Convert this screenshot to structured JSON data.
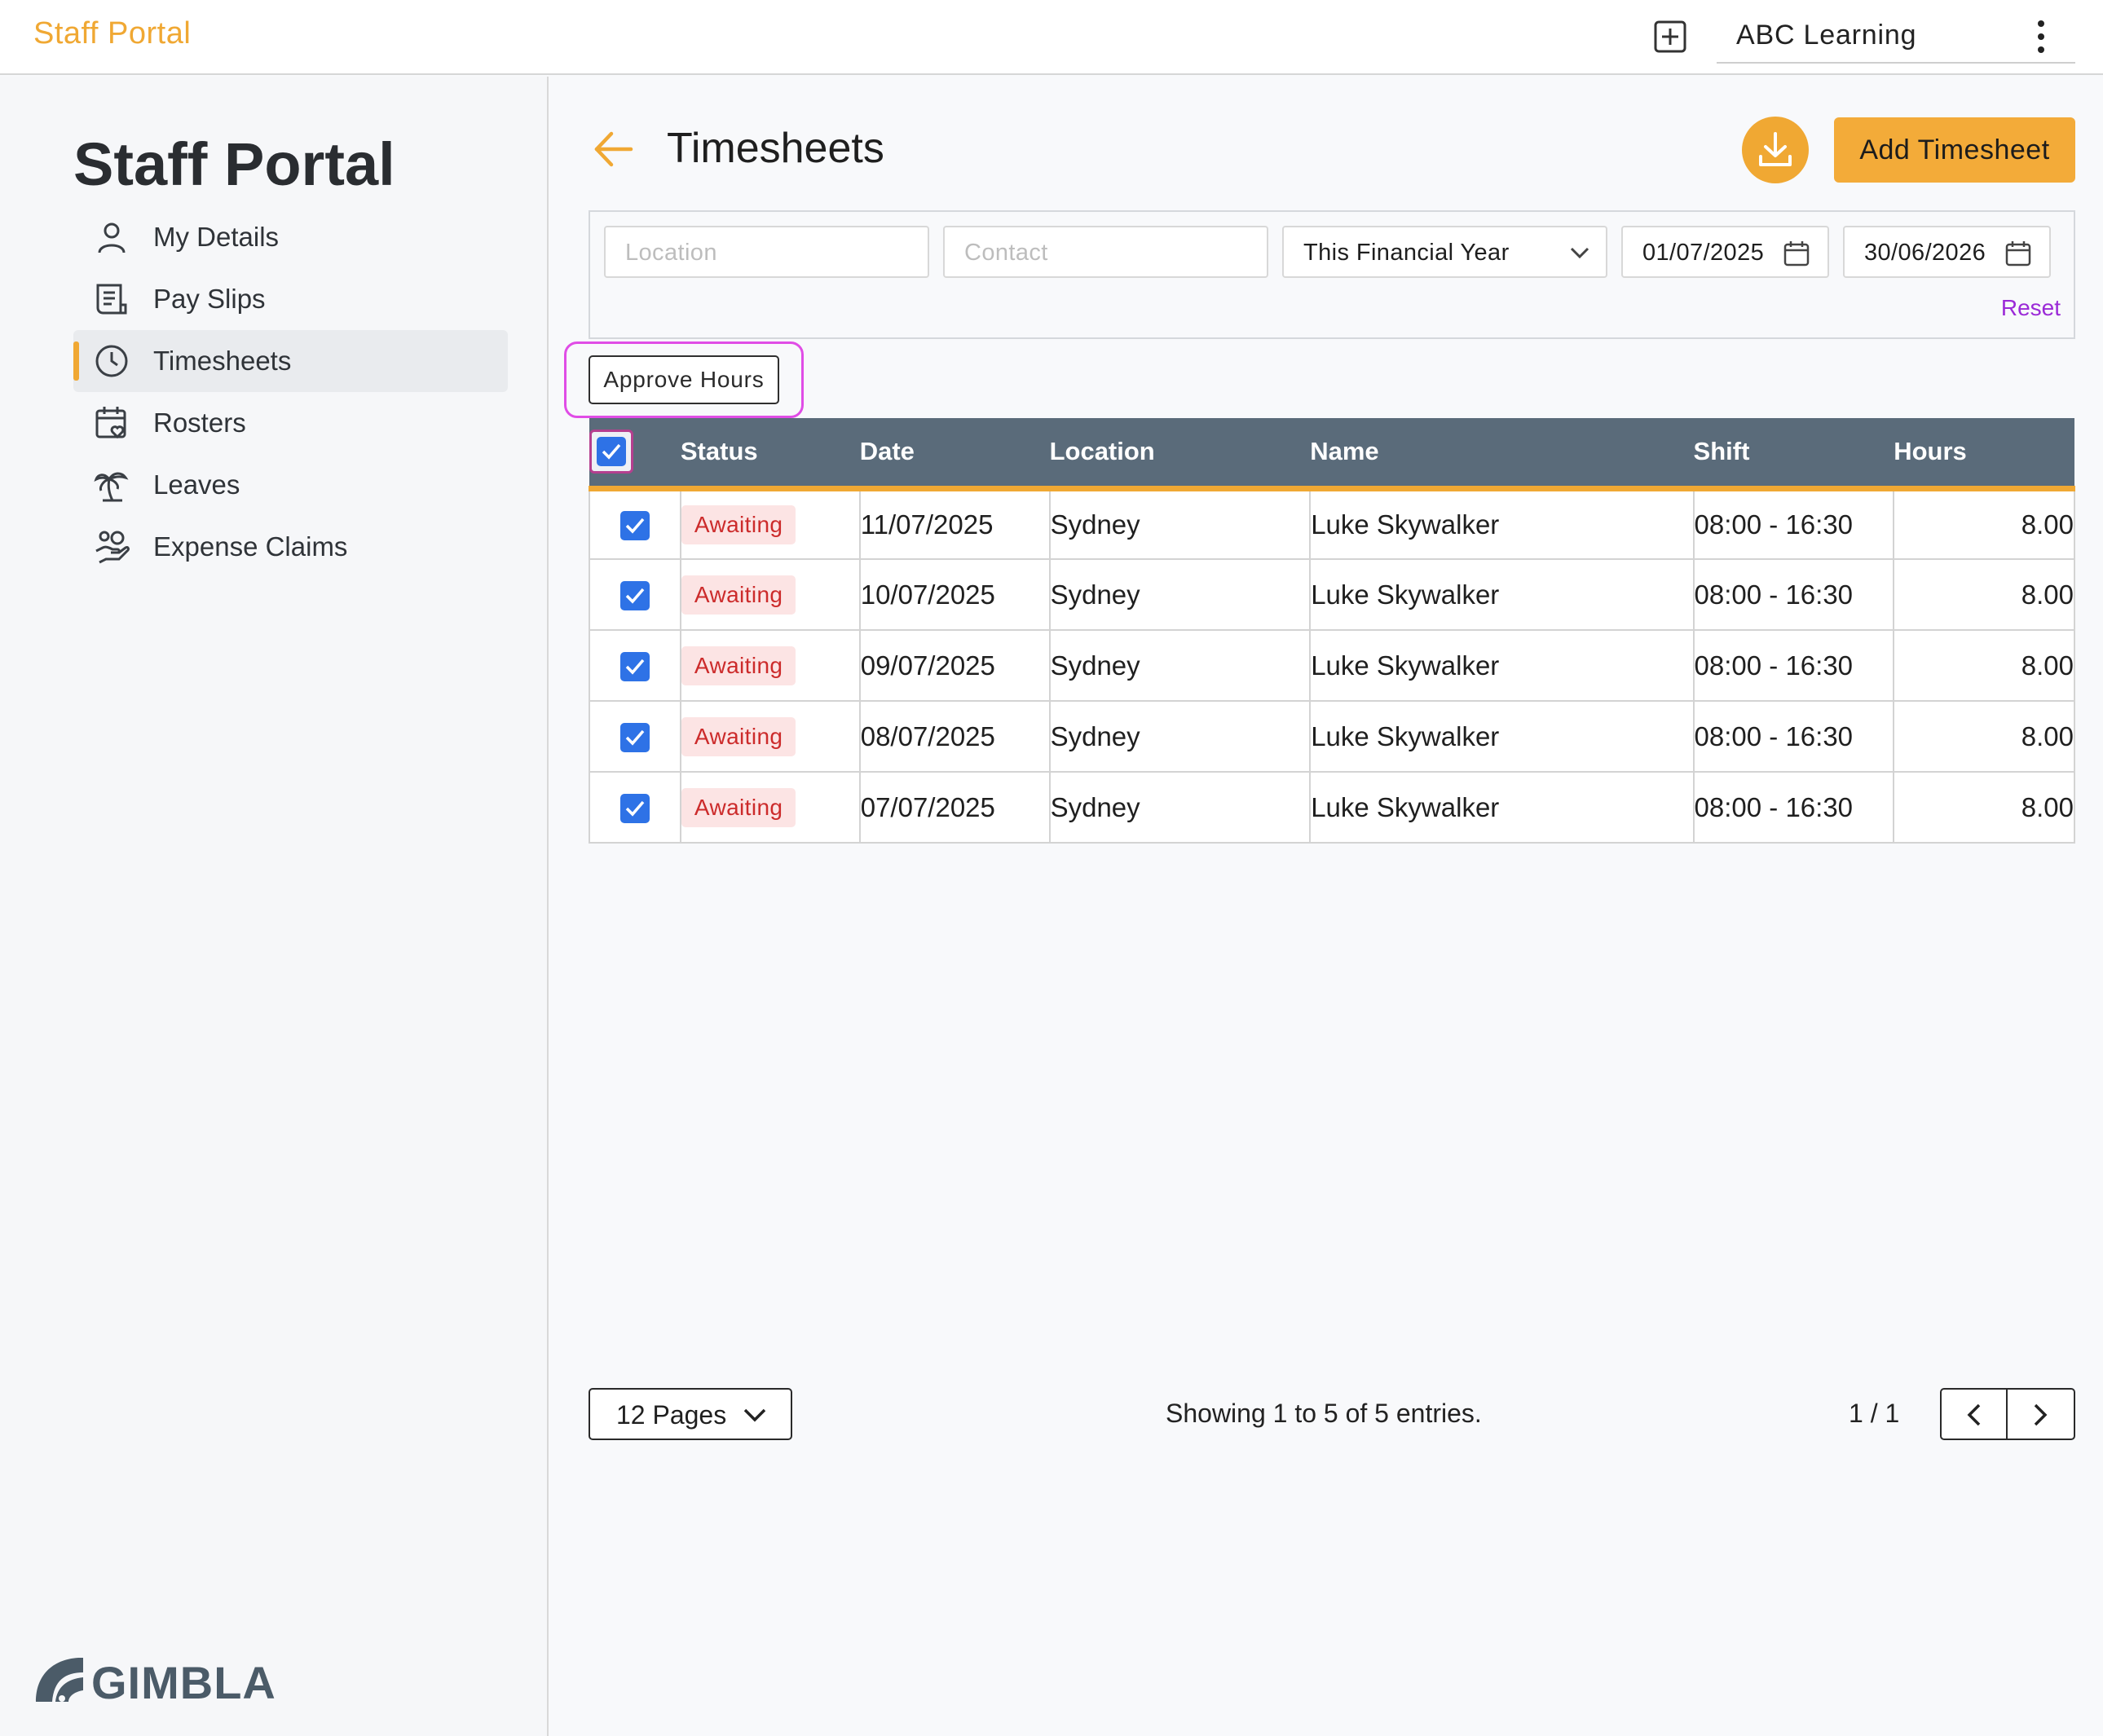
{
  "app": {
    "brand": "Staff Portal",
    "organization": "ABC Learning"
  },
  "sidebar": {
    "title": "Staff Portal",
    "items": [
      {
        "label": "My Details",
        "icon": "user-icon"
      },
      {
        "label": "Pay Slips",
        "icon": "receipt-icon"
      },
      {
        "label": "Timesheets",
        "icon": "clock-icon",
        "active": true
      },
      {
        "label": "Rosters",
        "icon": "calendar-heart-icon"
      },
      {
        "label": "Leaves",
        "icon": "palm-tree-icon"
      },
      {
        "label": "Expense Claims",
        "icon": "hand-coins-icon"
      }
    ],
    "logo": "GIMBLA"
  },
  "page": {
    "title": "Timesheets",
    "add_label": "Add Timesheet",
    "approve_label": "Approve Hours"
  },
  "filters": {
    "location_placeholder": "Location",
    "contact_placeholder": "Contact",
    "period": "This Financial Year",
    "date_from": "01/07/2025",
    "date_to": "30/06/2026",
    "reset_label": "Reset"
  },
  "table": {
    "headers": [
      "Status",
      "Date",
      "Location",
      "Name",
      "Shift",
      "Hours"
    ],
    "rows": [
      {
        "checked": true,
        "status": "Awaiting",
        "date": "11/07/2025",
        "location": "Sydney",
        "name": "Luke Skywalker",
        "shift": "08:00 - 16:30",
        "hours": "8.00"
      },
      {
        "checked": true,
        "status": "Awaiting",
        "date": "10/07/2025",
        "location": "Sydney",
        "name": "Luke Skywalker",
        "shift": "08:00 - 16:30",
        "hours": "8.00"
      },
      {
        "checked": true,
        "status": "Awaiting",
        "date": "09/07/2025",
        "location": "Sydney",
        "name": "Luke Skywalker",
        "shift": "08:00 - 16:30",
        "hours": "8.00"
      },
      {
        "checked": true,
        "status": "Awaiting",
        "date": "08/07/2025",
        "location": "Sydney",
        "name": "Luke Skywalker",
        "shift": "08:00 - 16:30",
        "hours": "8.00"
      },
      {
        "checked": true,
        "status": "Awaiting",
        "date": "07/07/2025",
        "location": "Sydney",
        "name": "Luke Skywalker",
        "shift": "08:00 - 16:30",
        "hours": "8.00"
      }
    ]
  },
  "pagination": {
    "page_size": "12 Pages",
    "summary": "Showing 1 to 5 of 5 entries.",
    "page_indicator": "1 / 1"
  },
  "colors": {
    "accent": "#f0a833",
    "header_bg": "#5a6b7a",
    "checkbox": "#2e72e6",
    "status_text": "#cc2b2b",
    "status_bg": "#fce4e4",
    "reset_link": "#9b2ad7",
    "highlight_ring": "#e04de6"
  }
}
